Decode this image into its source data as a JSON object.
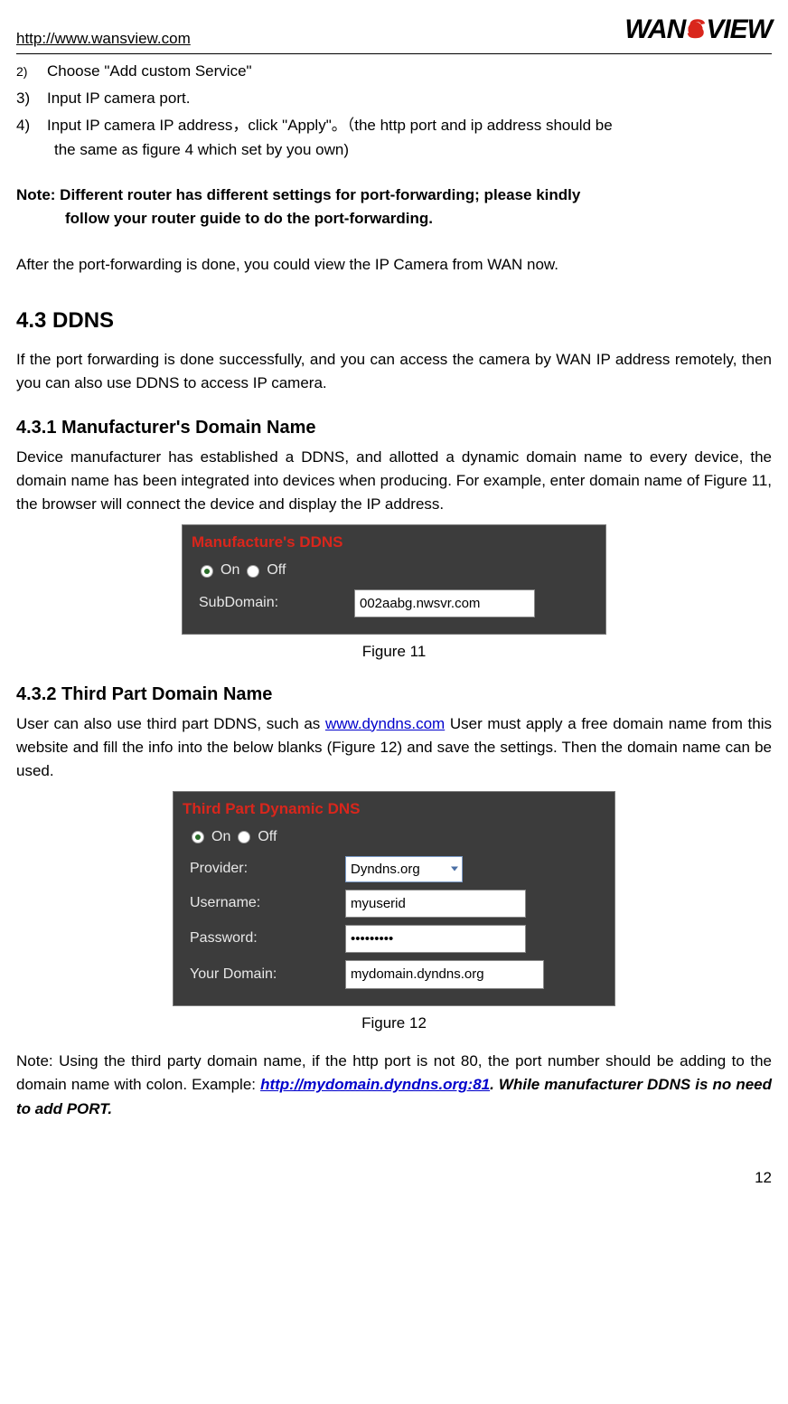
{
  "header": {
    "url": "http://www.wansview.com",
    "logo_pre": "WAN",
    "logo_s": "S",
    "logo_post": "VIEW"
  },
  "list": {
    "n2": "2)",
    "t2": "Choose \"Add custom Service\"",
    "n3": "3)",
    "t3": "Input IP camera port.",
    "n4": "4)",
    "t4a": "Input IP camera IP address，click \"Apply\"。（the http port and ip address should be",
    "t4b": "the same as figure 4 which set by you own)"
  },
  "note1a": "Note: Different router has different settings for port-forwarding; please kindly",
  "note1b": "follow your router guide to do the port-forwarding.",
  "para_after": "After the port-forwarding is done, you could view the IP Camera from WAN now.",
  "h43": "4.3  DDNS",
  "para43": "If the port forwarding is done successfully, and you can access the camera by WAN IP address remotely, then you can also use DDNS to access IP camera.",
  "h431": "4.3.1  Manufacturer's Domain Name",
  "para431": "Device manufacturer has established a DDNS, and allotted a dynamic domain name to every device, the domain name has been integrated into devices when producing. For example, enter domain name of Figure 11, the browser will connect the device and display the IP address.",
  "fig11": {
    "title": "Manufacture's DDNS",
    "on": "On",
    "off": "Off",
    "label": "SubDomain:",
    "value": "002aabg.nwsvr.com",
    "caption": "Figure 11"
  },
  "h432": "4.3.2  Third Part Domain Name",
  "para432a": "User can also use third part DDNS, such as ",
  "para432link": "www.dyndns.com",
  "para432b": " User must apply a free domain name from this website and fill the info into the below blanks (Figure 12) and save the settings. Then the domain name can be used.",
  "fig12": {
    "title": "Third Part Dynamic DNS",
    "on": "On",
    "off": "Off",
    "provider_label": "Provider:",
    "provider_value": "Dyndns.org",
    "user_label": "Username:",
    "user_value": "myuserid",
    "pass_label": "Password:",
    "pass_value": "•••••••••",
    "domain_label": "Your Domain:",
    "domain_value": "mydomain.dyndns.org",
    "caption": "Figure 12"
  },
  "note2a": "Note: Using the third party domain name, if the http port is not 80, the port number should be adding to the domain name with colon. Example: ",
  "note2link": "http://mydomain.dyndns.org:81",
  "note2b": ".  While manufacturer DDNS is no need to add PORT.",
  "page_num": "12"
}
